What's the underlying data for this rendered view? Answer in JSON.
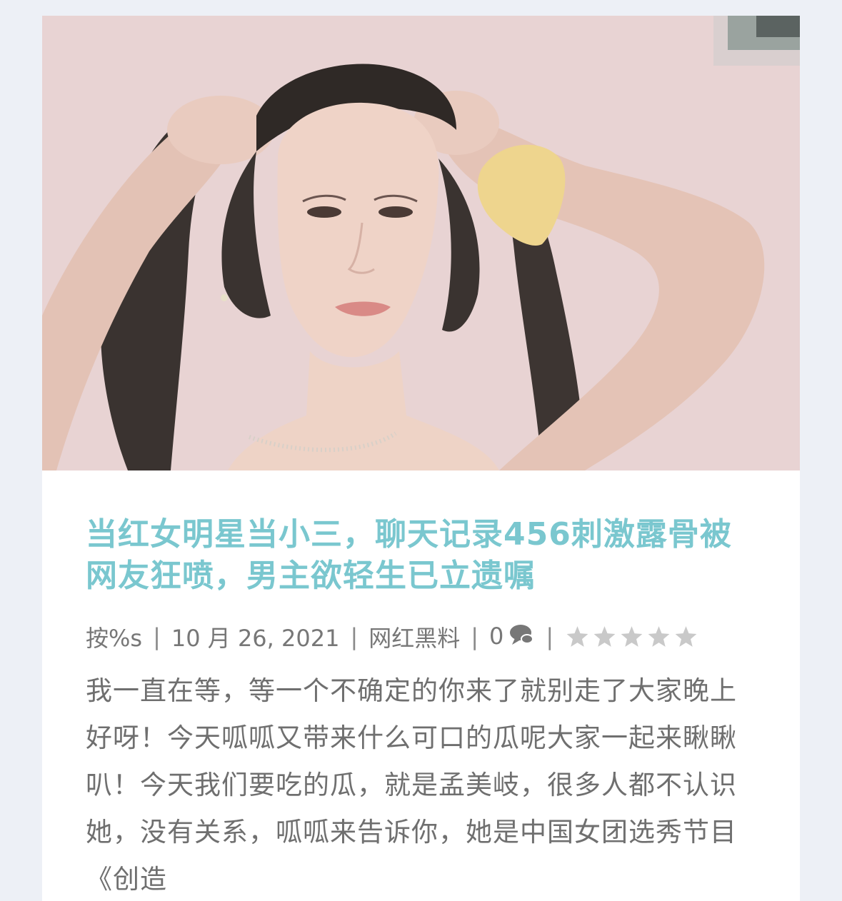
{
  "post": {
    "title": "当红女明星当小三，聊天记录456刺激露骨被网友狂喷，男主欲轻生已立遗嘱",
    "meta": {
      "author": "按%s",
      "date": "10 月 26, 2021",
      "category": "网红黑料",
      "comments": "0",
      "separator": "|"
    },
    "rating": {
      "stars_total": 5,
      "stars_filled": 0
    },
    "excerpt": "我一直在等，等一个不确定的你来了就别走了大家晚上好呀！今天呱呱又带来什么可口的瓜呢大家一起来瞅瞅叭！今天我们要吃的瓜，就是孟美岐，很多人都不认识她，没有关系，呱呱来告诉你，她是中国女团选秀节目《创造"
  },
  "icons": {
    "comment": "speech-bubble-icon",
    "rating": "star-icon"
  },
  "colors": {
    "title": "#7ac7cf",
    "meta_text": "#777777",
    "body_text": "#6f6f6f",
    "page_bg": "#edf0f6",
    "card_bg": "#ffffff",
    "star": "#c9c9c9"
  }
}
